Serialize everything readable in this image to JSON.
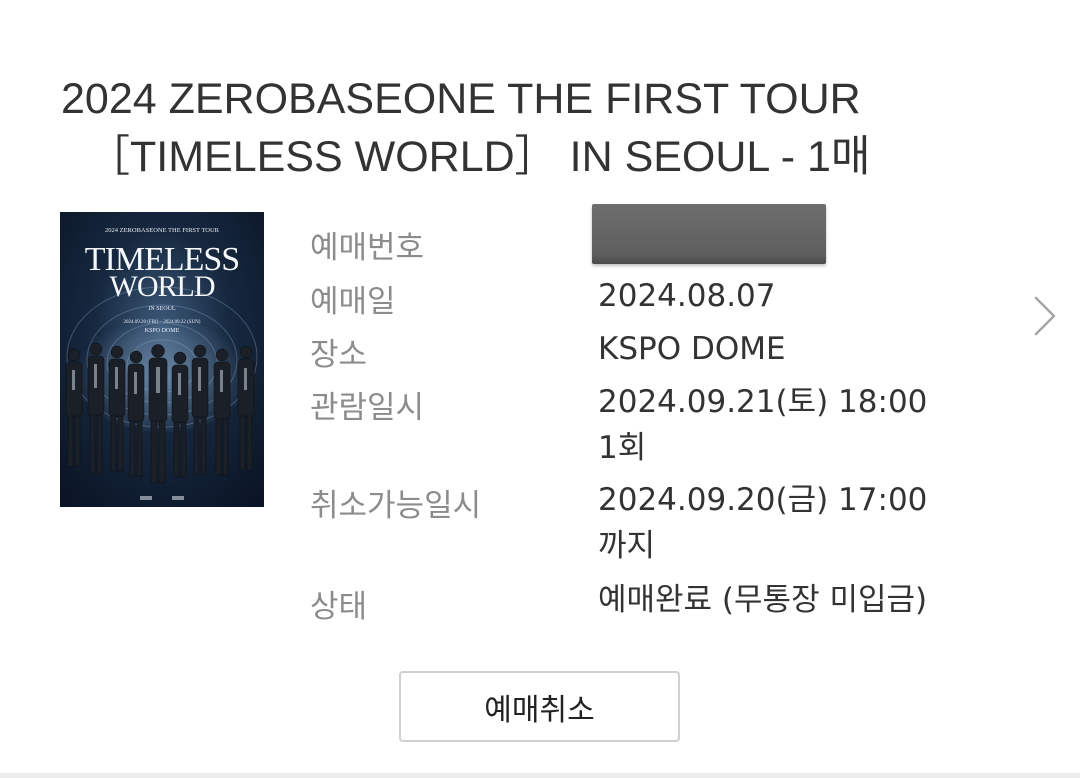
{
  "booking": {
    "title_line1": "2024 ZEROBASEONE THE FIRST TOUR",
    "title_line2": "［TIMELESS WORLD］ IN SEOUL - 1매"
  },
  "poster": {
    "top_text": "2024 ZEROBASEONE THE FIRST TOUR",
    "main_line1": "TIMELESS",
    "main_line2": "WORLD",
    "city": "IN SEOUL",
    "dates": "2024.09.20 (FRI) – 2024.09.22 (SUN)",
    "venue": "KSPO DOME"
  },
  "details": {
    "booking_no_label": "예매번호",
    "booking_date_label": "예매일",
    "booking_date": "2024.08.07",
    "venue_label": "장소",
    "venue": "KSPO DOME",
    "showtime_label": "관람일시",
    "showtime": "2024.09.21(토) 18:00",
    "showtime_round": "1회",
    "cancel_deadline_label": "취소가능일시",
    "cancel_deadline": "2024.09.20(금) 17:00",
    "cancel_deadline_suffix": "까지",
    "status_label": "상태",
    "status": "예매완료 (무통장 미입금)"
  },
  "actions": {
    "cancel_label": "예매취소"
  },
  "colors": {
    "label": "#8c8c8c",
    "value": "#333333",
    "button_border": "#d0d0d0",
    "redaction": "#606060"
  },
  "icons": {
    "next": "chevron-right-icon"
  }
}
